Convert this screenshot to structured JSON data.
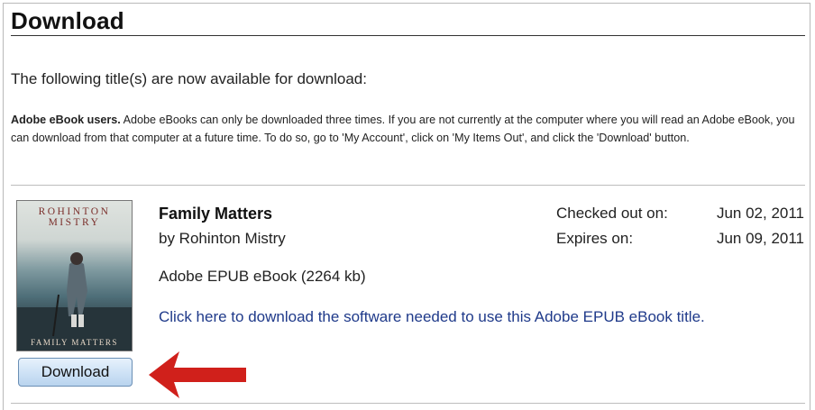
{
  "page": {
    "heading": "Download",
    "intro": "The following title(s) are now available for download:",
    "notice_bold": "Adobe eBook users.",
    "notice_text": " Adobe eBooks can only be downloaded three times. If you are not currently at the computer where you will read an Adobe eBook, you can download from that computer at a future time. To do so, go to 'My Account', click on 'My Items Out', and click the 'Download' button."
  },
  "book": {
    "cover_author": "ROHINTON MISTRY",
    "cover_title": "FAMILY MATTERS",
    "title": "Family Matters",
    "author": "by Rohinton Mistry",
    "format": "Adobe EPUB eBook (2264 kb)",
    "software_link": "Click here to download the software needed to use this Adobe EPUB eBook title.",
    "checked_out_label": "Checked out on:",
    "checked_out_date": "Jun 02, 2011",
    "expires_label": "Expires on:",
    "expires_date": "Jun 09, 2011",
    "download_button": "Download"
  },
  "colors": {
    "link": "#1f3a8a",
    "arrow": "#d0201b",
    "button_border": "#6a8fb5"
  },
  "icons": {
    "arrow": "red-left-arrow"
  }
}
